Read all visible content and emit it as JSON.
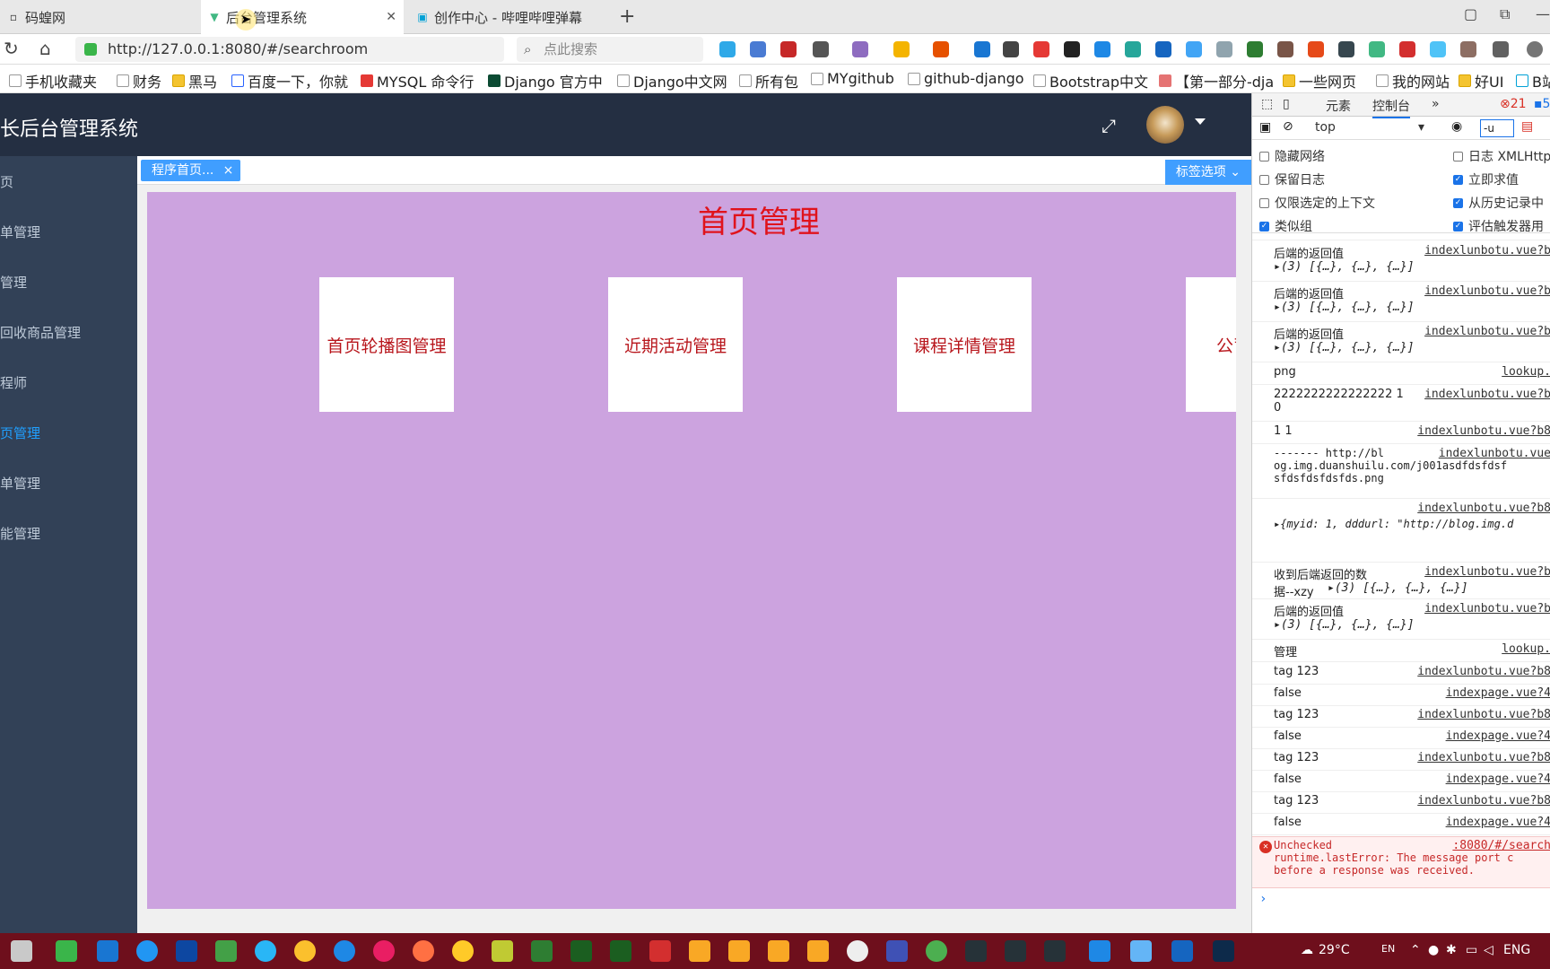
{
  "browser": {
    "tabs": [
      {
        "title": "码蝗网",
        "icon": "page-icon"
      },
      {
        "title": "后台管理系统",
        "icon": "vue-icon"
      },
      {
        "title": "创作中心 - 哔哩哔哩弹幕",
        "icon": "bilibili-icon"
      }
    ],
    "new_tab": "+",
    "url": "http://127.0.0.1:8080/#/searchroom",
    "search_placeholder": "点此搜索",
    "bookmarks": [
      "手机收藏夹",
      "财务",
      "黑马",
      "百度一下，你就",
      "MYSQL 命令行",
      "Django 官方中",
      "Django中文网",
      "所有包",
      "MYgithub",
      "github-django",
      "Bootstrap中文",
      "【第一部分-dja",
      "一些网页",
      "我的网站",
      "好UI",
      "B站"
    ]
  },
  "app": {
    "title": "长后台管理系统",
    "sidebar": [
      {
        "label": "页",
        "active": false
      },
      {
        "label": "单管理",
        "active": false
      },
      {
        "label": "管理",
        "active": false
      },
      {
        "label": "回收商品管理",
        "active": false
      },
      {
        "label": "程师",
        "active": false
      },
      {
        "label": "页管理",
        "active": true
      },
      {
        "label": "单管理",
        "active": false
      },
      {
        "label": "能管理",
        "active": false
      }
    ],
    "tag_home": "程序首页...",
    "tag_close": "×",
    "tag_options": "标签选项",
    "page_title": "首页管理",
    "cards": [
      "首页轮播图管理",
      "近期活动管理",
      "课程详情管理",
      "公司"
    ]
  },
  "devtools": {
    "tabs": [
      "元素",
      "控制台"
    ],
    "errors": "21",
    "warnings": "5",
    "context": "top",
    "filter": "-u",
    "settings": [
      {
        "label": "隐藏网络",
        "checked": false
      },
      {
        "label": "日志 XMLHttp",
        "checked": false
      },
      {
        "label": "保留日志",
        "checked": false
      },
      {
        "label": "立即求值",
        "checked": true
      },
      {
        "label": "仅限选定的上下文",
        "checked": false
      },
      {
        "label": "从历史记录中",
        "checked": true
      },
      {
        "label": "类似组",
        "checked": true
      },
      {
        "label": "评估触发器用",
        "checked": true
      }
    ],
    "logs": [
      {
        "msg": "后端的返回值",
        "src": "indexlunbotu.vue?b",
        "sub": "(3) [{…}, {…}, {…}]"
      },
      {
        "msg": "后端的返回值",
        "src": "indexlunbotu.vue?b",
        "sub": "(3) [{…}, {…}, {…}]"
      },
      {
        "msg": "后端的返回值",
        "src": "indexlunbotu.vue?b",
        "sub": "(3) [{…}, {…}, {…}]"
      },
      {
        "msg": "png",
        "src": "lookup.",
        "sub": ""
      },
      {
        "msg": "2222222222222222 1\n0",
        "src": "indexlunbotu.vue?b",
        "sub": ""
      },
      {
        "msg": "1 1",
        "src": "indexlunbotu.vue?b8",
        "sub": ""
      },
      {
        "msg": "------- http://bl\nog.img.duanshuilu.com/j001asdfdsfdsf\nsfdsfdsfdsfds.png",
        "src": "indexlunbotu.vue",
        "sub": ""
      },
      {
        "msg": "",
        "src": "indexlunbotu.vue?b8",
        "sub": "{myid: 1, dddurl: \"http://blog.img.d"
      },
      {
        "msg": "收到后端返回的数\n据--xzy",
        "src": "indexlunbotu.vue?b",
        "sub": "(3) [{…}, {…}, {…}]"
      },
      {
        "msg": "后端的返回值",
        "src": "indexlunbotu.vue?b",
        "sub": "(3) [{…}, {…}, {…}]"
      },
      {
        "msg": "管理",
        "src": "lookup.",
        "sub": ""
      },
      {
        "msg": "tag 123",
        "src": "indexlunbotu.vue?b8",
        "sub": ""
      },
      {
        "msg": "false",
        "src": "indexpage.vue?4",
        "sub": ""
      },
      {
        "msg": "tag 123",
        "src": "indexlunbotu.vue?b8",
        "sub": ""
      },
      {
        "msg": "false",
        "src": "indexpage.vue?4",
        "sub": ""
      },
      {
        "msg": "tag 123",
        "src": "indexlunbotu.vue?b8",
        "sub": ""
      },
      {
        "msg": "false",
        "src": "indexpage.vue?4",
        "sub": ""
      },
      {
        "msg": "tag 123",
        "src": "indexlunbotu.vue?b8",
        "sub": ""
      },
      {
        "msg": "false",
        "src": "indexpage.vue?4",
        "sub": ""
      }
    ],
    "error": {
      "msg": "Unchecked\nruntime.lastError: The message port c\nbefore a response was received.",
      "src": ":8080/#/search"
    },
    "prompt": "›"
  },
  "taskbar": {
    "weather": "29°C",
    "lang_short": "EN",
    "lang": "ENG"
  }
}
